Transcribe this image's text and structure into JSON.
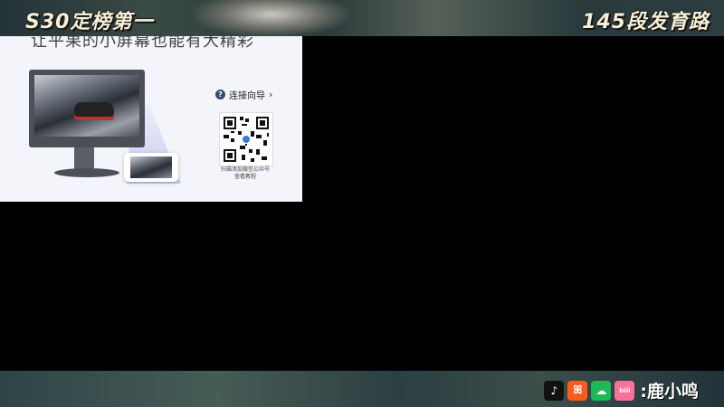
{
  "overlay": {
    "title_left": "S30定榜第一",
    "title_right": "145段发育路",
    "streamer_name": ":鹿小鸣",
    "socials": [
      {
        "name": "tiktok-icon",
        "glyph": "♪"
      },
      {
        "name": "kuaishou-icon",
        "glyph": "ꕤ"
      },
      {
        "name": "wechat-icon",
        "glyph": "☁"
      },
      {
        "name": "bilibili-icon",
        "glyph": "bili"
      }
    ]
  },
  "window": {
    "headline": "让平果的小屏幕也能有大精彩",
    "guide_label": "连接向导",
    "qr_caption_line1": "扫描添加微信公众号",
    "qr_caption_line2": "查看教程"
  },
  "colors": {
    "window_bg": "#f3f5fa",
    "accent": "#3a4c6c"
  }
}
